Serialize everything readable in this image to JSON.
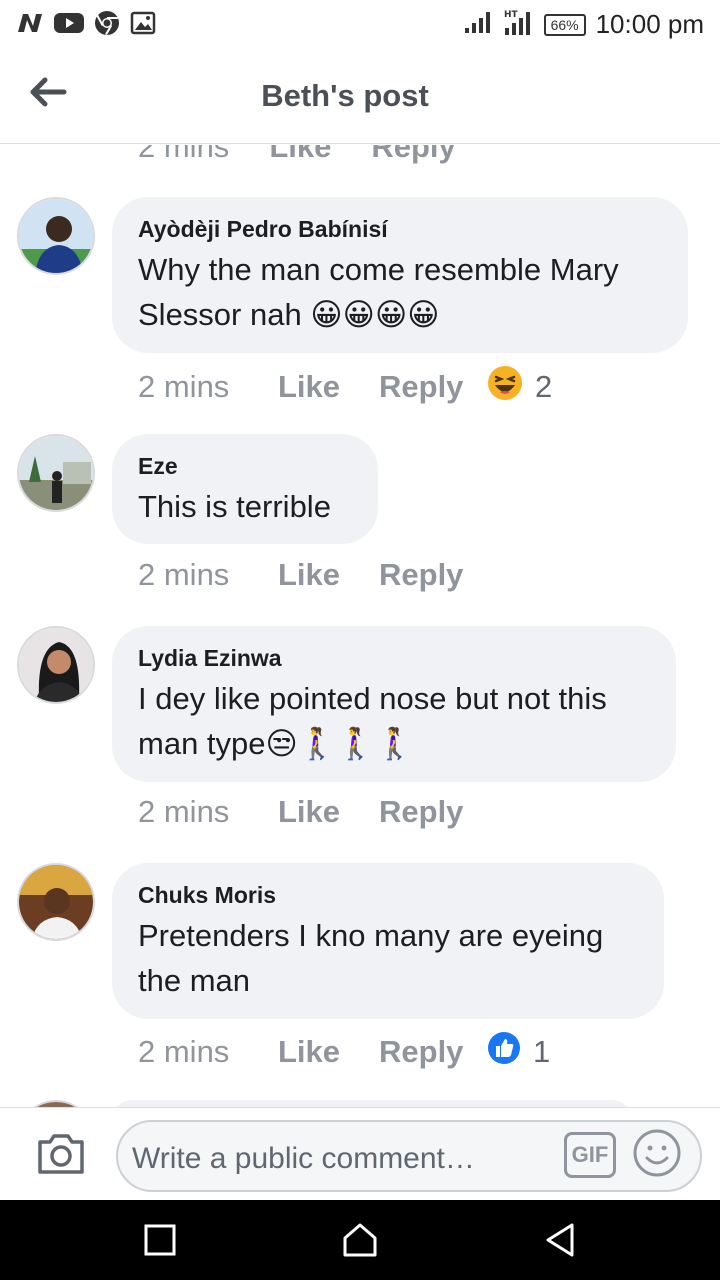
{
  "status_bar": {
    "battery": "66%",
    "time": "10:00 pm",
    "left_icons": [
      "n-icon",
      "youtube-icon",
      "chrome-icon",
      "image-icon"
    ],
    "right_icons": [
      "signal-icon",
      "signal-ht-icon"
    ]
  },
  "header": {
    "title": "Beth's post"
  },
  "partial_meta": {
    "time": "2 mins",
    "like": "Like",
    "reply": "Reply"
  },
  "comments": [
    {
      "author": "Ayòdèji Pedro Babínisí",
      "text": "Why the man come resemble Mary Slessor nah 😀😀😀😀",
      "time": "2 mins",
      "like": "Like",
      "reply": "Reply",
      "reaction": "haha",
      "reaction_count": "2"
    },
    {
      "author": "Eze",
      "text": "This is terrible",
      "time": "2 mins",
      "like": "Like",
      "reply": "Reply"
    },
    {
      "author": "Lydia Ezinwa",
      "text": "I dey like pointed nose but not this man type😒🚶‍♀️🚶‍♀️🚶‍♀️",
      "time": "2 mins",
      "like": "Like",
      "reply": "Reply"
    },
    {
      "author": "Chuks Moris",
      "text": "Pretenders I kno many are eyeing the man",
      "time": "2 mins",
      "like": "Like",
      "reply": "Reply",
      "reaction": "like",
      "reaction_count": "1"
    }
  ],
  "composer": {
    "placeholder": "Write a public comment…",
    "gif_label": "GIF"
  },
  "colors": {
    "bubble": "#f0f2f5",
    "meta_text": "#90949c",
    "like_blue": "#1877f2",
    "haha_yellow": "#f7b125"
  }
}
